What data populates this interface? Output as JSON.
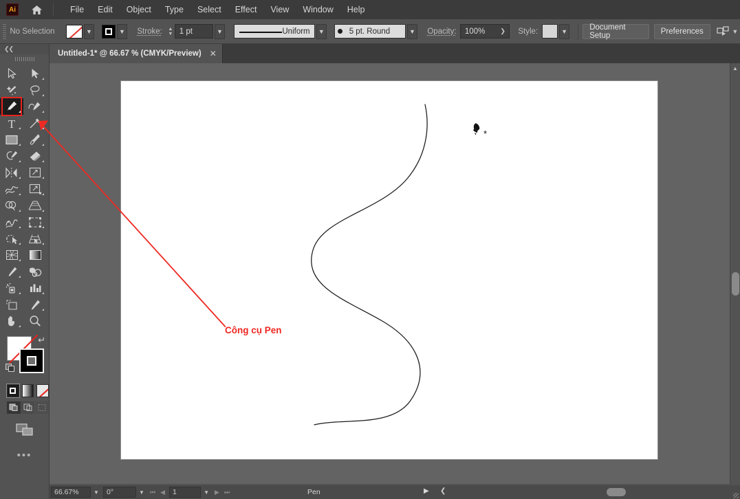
{
  "app": {
    "name": "Adobe Illustrator",
    "logo_text": "Ai",
    "logo_icon": "ai-logo-icon",
    "home_icon": "home-icon"
  },
  "menubar": {
    "items": [
      {
        "label": "File"
      },
      {
        "label": "Edit"
      },
      {
        "label": "Object"
      },
      {
        "label": "Type"
      },
      {
        "label": "Select"
      },
      {
        "label": "Effect"
      },
      {
        "label": "View"
      },
      {
        "label": "Window"
      },
      {
        "label": "Help"
      }
    ]
  },
  "controlbar": {
    "selection_status": "No Selection",
    "fill_label": "fill-swatch",
    "fill_value": "None",
    "stroke_swatch_label": "stroke-swatch",
    "stroke_value": "Black",
    "stroke_label": "Stroke:",
    "stroke_weight": "1 pt",
    "stroke_profile": "Uniform",
    "brush_definition": "5 pt. Round",
    "opacity_label": "Opacity:",
    "opacity_value": "100%",
    "style_label": "Style:",
    "style_value": "",
    "document_setup_label": "Document Setup",
    "preferences_label": "Preferences",
    "arrange_icon": "arrange-documents-icon"
  },
  "tabs": [
    {
      "title": "Untitled-1* @ 66.67 % (CMYK/Preview)",
      "close_icon": "close-icon",
      "active": true
    }
  ],
  "toolbar": {
    "collapse_icon": "double-chevron-left-icon",
    "grip": "panel-grip-handle",
    "more_icon": "more-tools-icon",
    "tools": [
      {
        "name": "selection-tool",
        "icon": "arrow-cursor-icon",
        "has_flyout": false
      },
      {
        "name": "direct-selection-tool",
        "icon": "white-arrow-cursor-icon",
        "has_flyout": true
      },
      {
        "name": "magic-wand-tool",
        "icon": "magic-wand-icon",
        "has_flyout": false
      },
      {
        "name": "lasso-tool",
        "icon": "lasso-icon",
        "has_flyout": true
      },
      {
        "name": "pen-tool",
        "icon": "pen-nib-icon",
        "has_flyout": true,
        "active": true,
        "highlighted": true
      },
      {
        "name": "curvature-tool",
        "icon": "curvature-pen-icon",
        "has_flyout": true
      },
      {
        "name": "type-tool",
        "icon": "type-t-icon",
        "has_flyout": true
      },
      {
        "name": "line-segment-tool",
        "icon": "line-segment-icon",
        "has_flyout": true
      },
      {
        "name": "rectangle-tool",
        "icon": "rectangle-icon",
        "has_flyout": true
      },
      {
        "name": "paintbrush-tool",
        "icon": "paintbrush-icon",
        "has_flyout": true
      },
      {
        "name": "shaper-tool",
        "icon": "shaper-pencil-icon",
        "has_flyout": true
      },
      {
        "name": "eraser-tool",
        "icon": "eraser-icon",
        "has_flyout": true
      },
      {
        "name": "rotate-tool",
        "icon": "reflect-icon",
        "has_flyout": true
      },
      {
        "name": "scale-tool",
        "icon": "scale-icon",
        "has_flyout": true
      },
      {
        "name": "width-tool",
        "icon": "width-warp-icon",
        "has_flyout": true
      },
      {
        "name": "free-transform-tool",
        "icon": "free-transform-icon",
        "has_flyout": true
      },
      {
        "name": "shape-builder-tool",
        "icon": "shape-builder-icon",
        "has_flyout": true
      },
      {
        "name": "perspective-grid-tool",
        "icon": "perspective-grid-icon",
        "has_flyout": true
      },
      {
        "name": "mesh-tool",
        "icon": "mesh-icon",
        "has_flyout": true
      },
      {
        "name": "gradient-tool",
        "icon": "gradient-icon",
        "has_flyout": false
      },
      {
        "name": "eyedropper-tool",
        "icon": "eyedropper-icon",
        "has_flyout": true
      },
      {
        "name": "blend-tool",
        "icon": "blend-icon",
        "has_flyout": false
      },
      {
        "name": "symbol-sprayer-tool",
        "icon": "symbol-sprayer-icon",
        "has_flyout": true
      },
      {
        "name": "column-graph-tool",
        "icon": "bar-chart-icon",
        "has_flyout": true
      },
      {
        "name": "artboard-tool",
        "icon": "artboard-icon",
        "has_flyout": false
      },
      {
        "name": "slice-tool",
        "icon": "slice-knife-icon",
        "has_flyout": true
      },
      {
        "name": "hand-tool",
        "icon": "hand-icon",
        "has_flyout": true
      },
      {
        "name": "zoom-tool",
        "icon": "magnifier-icon",
        "has_flyout": false
      }
    ],
    "fill_stroke": {
      "fill_name": "fill-indicator",
      "fill_value": "None",
      "stroke_name": "stroke-indicator",
      "stroke_value": "Black",
      "swap_icon": "swap-fill-stroke-icon",
      "default_icon": "default-fill-stroke-icon"
    },
    "color_modes": [
      {
        "name": "color-mode-solid",
        "icon": "solid-color-icon",
        "selected": true
      },
      {
        "name": "color-mode-gradient",
        "icon": "gradient-swatch-icon",
        "selected": false
      },
      {
        "name": "color-mode-none",
        "icon": "none-swatch-icon",
        "selected": false
      }
    ],
    "draw_modes": [
      {
        "name": "draw-normal-mode",
        "icon": "draw-normal-icon",
        "selected": true,
        "disabled": false
      },
      {
        "name": "draw-behind-mode",
        "icon": "draw-behind-icon",
        "selected": false,
        "disabled": false
      },
      {
        "name": "draw-inside-mode",
        "icon": "draw-inside-icon",
        "selected": false,
        "disabled": true
      }
    ],
    "screen_mode": {
      "name": "change-screen-mode",
      "icon": "screen-mode-icon"
    }
  },
  "canvas": {
    "artboard_name": "artboard",
    "pen_cursor_icon": "pen-nib-cursor-with-asterisk-icon",
    "path_name": "bezier-s-curve-path",
    "path_stroke_color": "#1a1a1a",
    "path_fill": "none"
  },
  "annotation": {
    "text": "Công cụ Pen",
    "text_color": "#ef2722",
    "arrow_color": "#ed2a24",
    "highlight_color": "#e8231e",
    "arrow_name": "callout-arrow",
    "highlight_name": "pen-tool-highlight-box"
  },
  "statusbar": {
    "zoom_level": "66.67%",
    "rotation": "0°",
    "artboard_number": "1",
    "current_tool": "Pen",
    "first_icon": "first-artboard-icon",
    "prev_icon": "previous-artboard-icon",
    "next_icon": "next-artboard-icon",
    "last_icon": "last-artboard-icon"
  },
  "scrollbars": {
    "vertical_name": "vertical-scrollbar",
    "horizontal_name": "horizontal-scrollbar",
    "up_icon": "chevron-up-icon"
  }
}
